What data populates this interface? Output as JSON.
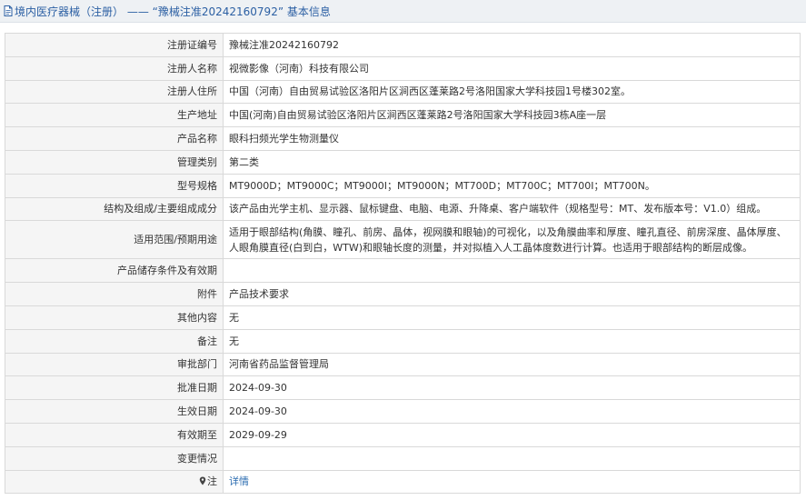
{
  "header": {
    "title": "境内医疗器械（注册） ——  “豫械注准20242160792”  基本信息",
    "icon": "document-icon",
    "accent_color": "#2b5fa3"
  },
  "rows": [
    {
      "label": "注册证编号",
      "value": "豫械注准20242160792"
    },
    {
      "label": "注册人名称",
      "value": "视微影像（河南）科技有限公司"
    },
    {
      "label": "注册人住所",
      "value": "中国（河南）自由贸易试验区洛阳片区涧西区蓬莱路2号洛阳国家大学科技园1号楼302室。"
    },
    {
      "label": "生产地址",
      "value": "中国(河南)自由贸易试验区洛阳片区涧西区蓬莱路2号洛阳国家大学科技园3栋A座一层"
    },
    {
      "label": "产品名称",
      "value": "眼科扫频光学生物测量仪"
    },
    {
      "label": "管理类别",
      "value": "第二类"
    },
    {
      "label": "型号规格",
      "value": "MT9000D；MT9000C；MT9000I；MT9000N；MT700D；MT700C；MT700I；MT700N。"
    },
    {
      "label": "结构及组成/主要组成成分",
      "value": "该产品由光学主机、显示器、鼠标键盘、电脑、电源、升降桌、客户端软件（规格型号：MT、发布版本号：V1.0）组成。"
    },
    {
      "label": "适用范围/预期用途",
      "value": "适用于眼部结构(角膜、瞳孔、前房、晶体，视网膜和眼轴)的可视化，以及角膜曲率和厚度、瞳孔直径、前房深度、晶体厚度、人眼角膜直径(白到白，WTW)和眼轴长度的测量，并对拟植入人工晶体度数进行计算。也适用于眼部结构的断层成像。"
    },
    {
      "label": "产品储存条件及有效期",
      "value": ""
    },
    {
      "label": "附件",
      "value": "产品技术要求"
    },
    {
      "label": "其他内容",
      "value": "无"
    },
    {
      "label": "备注",
      "value": "无"
    },
    {
      "label": "审批部门",
      "value": "河南省药品监督管理局"
    },
    {
      "label": "批准日期",
      "value": "2024-09-30"
    },
    {
      "label": "生效日期",
      "value": "2024-09-30"
    },
    {
      "label": "有效期至",
      "value": "2029-09-29"
    },
    {
      "label": "变更情况",
      "value": ""
    }
  ],
  "note_row": {
    "icon": "map-pin-icon",
    "label": "注",
    "link_text": "详情",
    "link_color": "#2b6cb0"
  }
}
